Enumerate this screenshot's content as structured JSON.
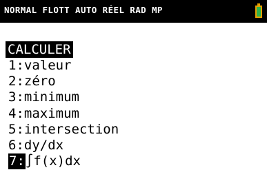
{
  "status_bar": {
    "text": "NORMAL FLOTT AUTO RÉEL RAD MP",
    "battery_icon": "battery-icon",
    "battery_color": "#e8a000",
    "battery_fill_color": "#2fb24a"
  },
  "menu": {
    "title": "CALCULER",
    "items": [
      {
        "num": "1:",
        "label": "valeur",
        "selected": false
      },
      {
        "num": "2:",
        "label": "zéro",
        "selected": false
      },
      {
        "num": "3:",
        "label": "minimum",
        "selected": false
      },
      {
        "num": "4:",
        "label": "maximum",
        "selected": false
      },
      {
        "num": "5:",
        "label": "intersection",
        "selected": false
      },
      {
        "num": "6:",
        "label": "dy/dx",
        "selected": false
      },
      {
        "num": "7:",
        "label": "∫f(x)dx",
        "selected": true
      }
    ]
  }
}
